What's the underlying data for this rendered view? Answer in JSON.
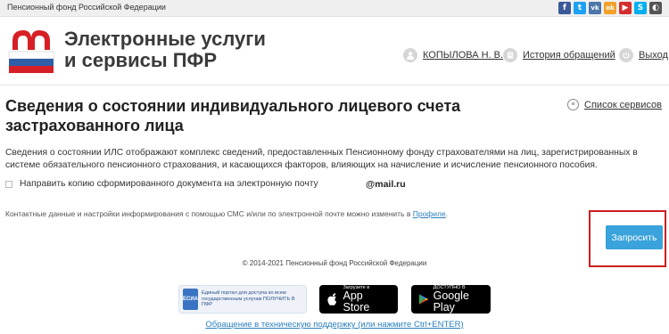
{
  "topbar": {
    "org": "Пенсионный фонд Российской Федерации",
    "social": [
      {
        "name": "facebook-icon",
        "glyph": "f",
        "color": "#3b5998"
      },
      {
        "name": "twitter-icon",
        "glyph": "t",
        "color": "#1da1f2"
      },
      {
        "name": "vk-icon",
        "glyph": "vk",
        "color": "#4a76a8"
      },
      {
        "name": "odnoklassniki-icon",
        "glyph": "ok",
        "color": "#f2a12a"
      },
      {
        "name": "youtube-icon",
        "glyph": "▶",
        "color": "#d32f2f"
      },
      {
        "name": "skype-icon",
        "glyph": "S",
        "color": "#00aff0"
      },
      {
        "name": "low-vision-icon",
        "glyph": "◐",
        "color": "#555555"
      }
    ]
  },
  "header": {
    "brand_line1": "Электронные услуги",
    "brand_line2": "и сервисы ПФР",
    "user_name": "КОПЫЛОВА Н. В.",
    "history_label": "История обращений",
    "logout_label": "Выход"
  },
  "main": {
    "title": "Сведения о состоянии индивидуального лицевого счета застрахованного лица",
    "services_label": "Список сервисов",
    "description": "Сведения о состоянии ИЛС отображают комплекс сведений, предоставленных Пенсионному фонду страхователями на лиц, зарегистрированных в системе обязательного пенсионного страхования, и касающихся факторов, влияющих на начисление и исчисление пенсионного пособия.",
    "copy_checkbox_label": "Направить копию сформированного документа на электронную почту",
    "email": "@mail.ru",
    "contact_text": "Контактные данные и настройки информирования с помощью СМС и/или по электронной почте можно изменить в ",
    "contact_link": "Профиле",
    "contact_suffix": ".",
    "submit_label": "Запросить"
  },
  "footer": {
    "copyright": "© 2014-2021 Пенсионный фонд Российской Федерации",
    "esia_text": "Единый портал для доступа ко всем государственным услугам ПОЛУЧИТЬ В ПФР",
    "esia_logo": "ЕСИА",
    "appstore_small": "Загрузите в",
    "appstore_big": "App Store",
    "gplay_small": "ДОСТУПНО В",
    "gplay_big": "Google Play",
    "support": "Обращение в техническую поддержку (или нажмите Ctrl+ENTER)"
  },
  "colors": {
    "accent": "#3aa3dc",
    "highlight": "#cc1f1f",
    "link": "#2a7fbf"
  }
}
